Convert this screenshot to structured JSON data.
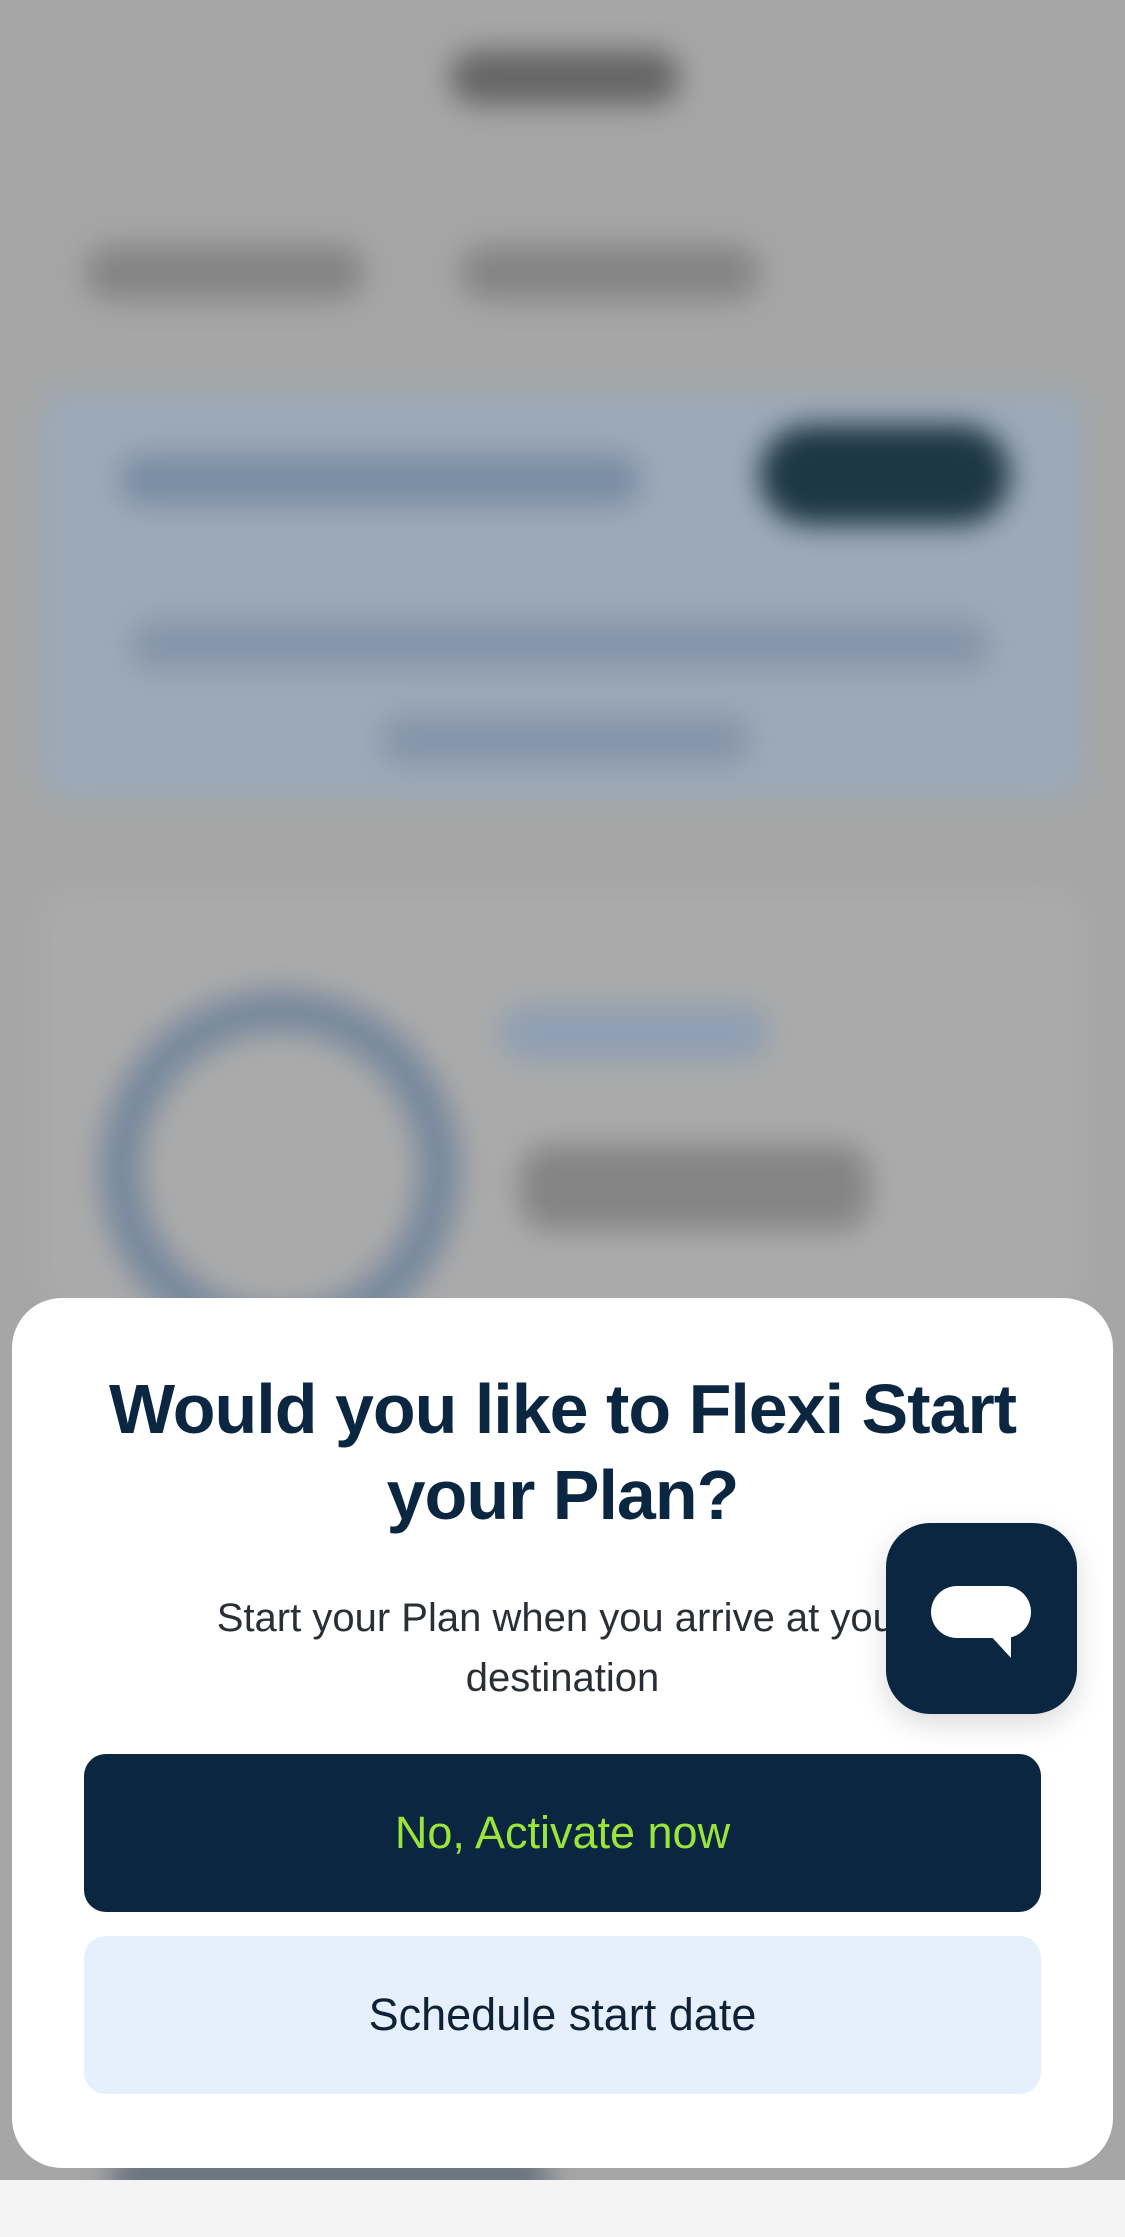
{
  "dialog": {
    "title": "Would you like to Flexi Start your Plan?",
    "subtitle": "Start your Plan when you arrive at your destination",
    "primary_label": "No, Activate now",
    "secondary_label": "Schedule start date"
  },
  "chat": {
    "icon": "chat-bubble-icon"
  },
  "colors": {
    "navy": "#0a2640",
    "lime": "#9be43a",
    "light_blue": "#e6f0fc",
    "backdrop": "#adadad"
  }
}
